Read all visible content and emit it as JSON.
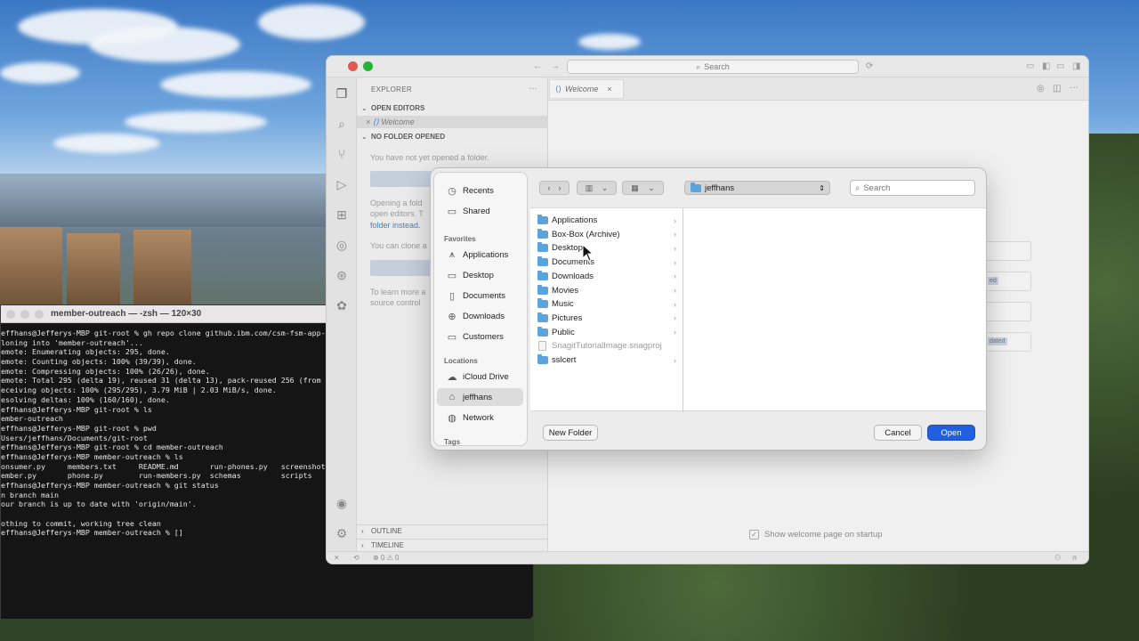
{
  "terminal": {
    "title": "member-outreach — -zsh — 120×30",
    "lines": [
      "effhans@Jefferys-MBP git-root % gh repo clone github.ibm.com/csm-fsm-app-i",
      "loning into 'member-outreach'...",
      "emote: Enumerating objects: 295, done.",
      "emote: Counting objects: 100% (39/39), done.",
      "emote: Compressing objects: 100% (26/26), done.",
      "emote: Total 295 (delta 19), reused 31 (delta 13), pack-reused 256 (from 1",
      "eceiving objects: 100% (295/295), 3.79 MiB | 2.03 MiB/s, done.",
      "esolving deltas: 100% (160/160), done.",
      "effhans@Jefferys-MBP git-root % ls",
      "ember-outreach",
      "effhans@Jefferys-MBP git-root % pwd",
      "Users/jeffhans/Documents/git-root",
      "effhans@Jefferys-MBP git-root % cd member-outreach",
      "effhans@Jefferys-MBP member-outreach % ls",
      "onsumer.py     members.txt     README.md       run-phones.py   screenshots",
      "ember.py       phone.py        run-members.py  schemas         scripts",
      "effhans@Jefferys-MBP member-outreach % git status",
      "n branch main",
      "our branch is up to date with 'origin/main'.",
      "",
      "othing to commit, working tree clean",
      "effhans@Jefferys-MBP member-outreach % []"
    ]
  },
  "editor": {
    "command_search": "Search",
    "explorer_label": "EXPLORER",
    "open_editors": "OPEN EDITORS",
    "open_editor_item": "Welcome",
    "no_folder": "NO FOLDER OPENED",
    "no_folder_msg": "You have not yet opened a folder.",
    "open_text_1": "Opening a fold",
    "open_text_2": "open editors. T",
    "open_text_3": "folder instead.",
    "clone_text": "You can clone a",
    "learn_text_1": "To learn more a",
    "learn_text_2": "source control",
    "outline": "OUTLINE",
    "timeline": "TIMELINE",
    "tab": "Welcome",
    "welcome_checkbox": "Show welcome page on startup",
    "status_counts": "0 ⚠ 0",
    "ghost_badge_1": "ed",
    "ghost_badge_2": "dated"
  },
  "dialog": {
    "sidebar": {
      "top": [
        {
          "label": "Recents",
          "icon": "clock-icon"
        },
        {
          "label": "Shared",
          "icon": "shared-folder-icon"
        }
      ],
      "favorites_label": "Favorites",
      "favorites": [
        {
          "label": "Applications",
          "icon": "applications-icon"
        },
        {
          "label": "Desktop",
          "icon": "desktop-icon"
        },
        {
          "label": "Documents",
          "icon": "document-icon"
        },
        {
          "label": "Downloads",
          "icon": "download-icon"
        },
        {
          "label": "Customers",
          "icon": "folder-icon"
        }
      ],
      "locations_label": "Locations",
      "locations": [
        {
          "label": "iCloud Drive",
          "icon": "cloud-icon"
        },
        {
          "label": "jeffhans",
          "icon": "home-icon",
          "selected": true
        },
        {
          "label": "Network",
          "icon": "globe-icon"
        }
      ],
      "tags_label": "Tags"
    },
    "path": "jeffhans",
    "search_placeholder": "Search",
    "files": [
      {
        "name": "Applications",
        "folder": true
      },
      {
        "name": "Box-Box (Archive)",
        "folder": true
      },
      {
        "name": "Desktop",
        "folder": true
      },
      {
        "name": "Documents",
        "folder": true
      },
      {
        "name": "Downloads",
        "folder": true
      },
      {
        "name": "Movies",
        "folder": true
      },
      {
        "name": "Music",
        "folder": true
      },
      {
        "name": "Pictures",
        "folder": true
      },
      {
        "name": "Public",
        "folder": true
      },
      {
        "name": "SnagitTutorialImage.snagproj",
        "folder": false
      },
      {
        "name": "sslcert",
        "folder": true
      }
    ],
    "new_folder": "New Folder",
    "cancel": "Cancel",
    "open": "Open",
    "accent": "#1f5fe0"
  }
}
